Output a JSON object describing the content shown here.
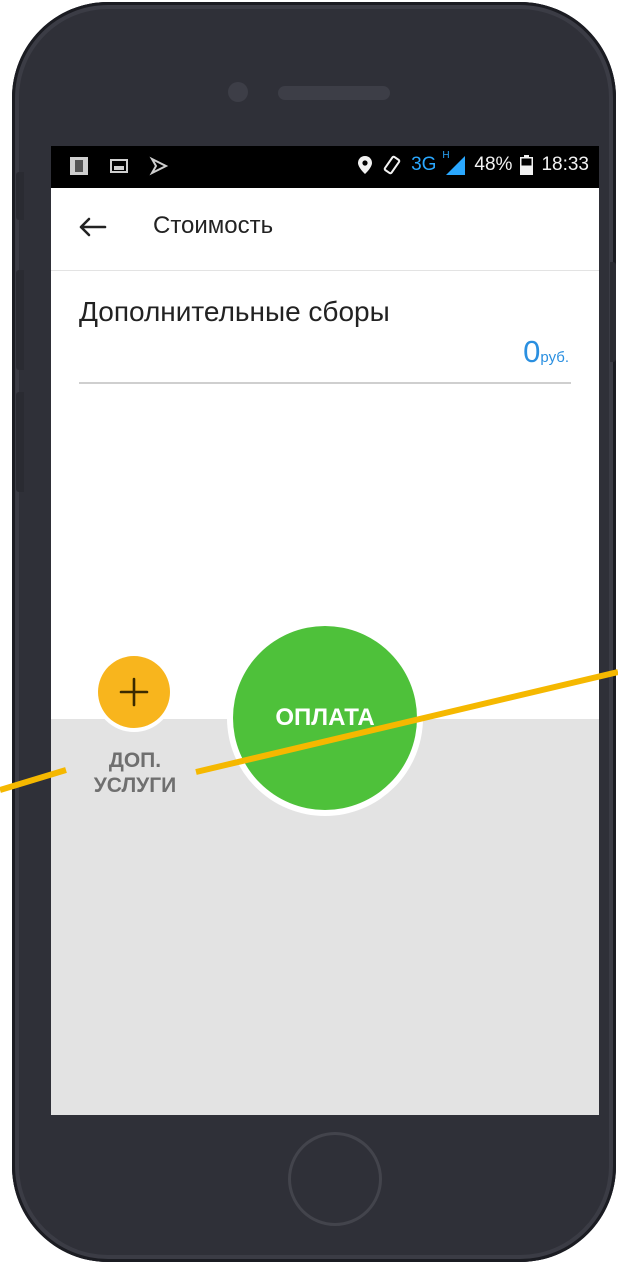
{
  "status_bar": {
    "network": "3G",
    "signal_badge": "H",
    "battery": "48%",
    "time": "18:33"
  },
  "toolbar": {
    "title": "Стоимость"
  },
  "fees": {
    "label": "Дополнительные сборы",
    "amount": "0",
    "unit": "руб."
  },
  "actions": {
    "add_services_label_line1": "ДОП.",
    "add_services_label_line2": "УСЛУГИ",
    "pay_label": "ОПЛАТА"
  },
  "colors": {
    "accent_blue": "#2a8fe0",
    "pay_green": "#4ec13a",
    "add_yellow": "#f8b51d",
    "callout_line": "#f5b800"
  },
  "icons": [
    "back-arrow-icon",
    "plus-icon",
    "location-pin-icon",
    "rotate-icon",
    "signal-icon",
    "battery-icon",
    "app-notification-icon",
    "image-icon",
    "checkmark-flag-icon"
  ]
}
